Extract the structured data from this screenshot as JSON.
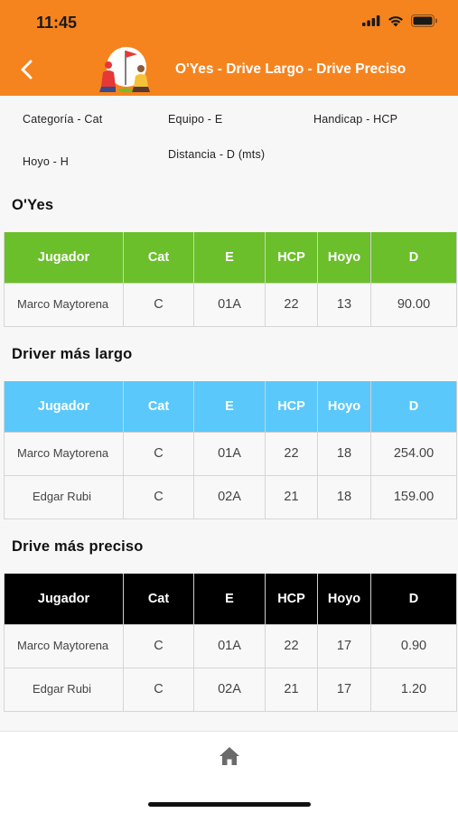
{
  "status_bar": {
    "time": "11:45"
  },
  "header": {
    "title": "O'Yes - Drive Largo - Drive Preciso",
    "brand_color": "#f5841f"
  },
  "legend": {
    "categoria": "Categoría - Cat",
    "equipo": "Equipo - E",
    "handicap": "Handicap - HCP",
    "hoyo": "Hoyo - H",
    "distancia": "Distancia - D (mts)"
  },
  "columns": [
    "Jugador",
    "Cat",
    "E",
    "HCP",
    "Hoyo",
    "D"
  ],
  "sections": [
    {
      "title": "O'Yes",
      "header_color": "#6bbf2a",
      "rows": [
        {
          "jugador": "Marco Maytorena",
          "cat": "C",
          "e": "01A",
          "hcp": "22",
          "hoyo": "13",
          "d": "90.00"
        }
      ]
    },
    {
      "title": "Driver más largo",
      "header_color": "#5ac8fa",
      "rows": [
        {
          "jugador": "Marco Maytorena",
          "cat": "C",
          "e": "01A",
          "hcp": "22",
          "hoyo": "18",
          "d": "254.00"
        },
        {
          "jugador": "Edgar Rubi",
          "cat": "C",
          "e": "02A",
          "hcp": "21",
          "hoyo": "18",
          "d": "159.00"
        }
      ]
    },
    {
      "title": "Drive más preciso",
      "header_color": "#000000",
      "rows": [
        {
          "jugador": "Marco Maytorena",
          "cat": "C",
          "e": "01A",
          "hcp": "22",
          "hoyo": "17",
          "d": "0.90"
        },
        {
          "jugador": "Edgar Rubi",
          "cat": "C",
          "e": "02A",
          "hcp": "21",
          "hoyo": "17",
          "d": "1.20"
        }
      ]
    }
  ],
  "icons": {
    "back": "chevron-left-icon",
    "home": "home-icon",
    "signal": "signal-icon",
    "wifi": "wifi-icon",
    "battery": "battery-icon",
    "logo": "golf-logo"
  }
}
